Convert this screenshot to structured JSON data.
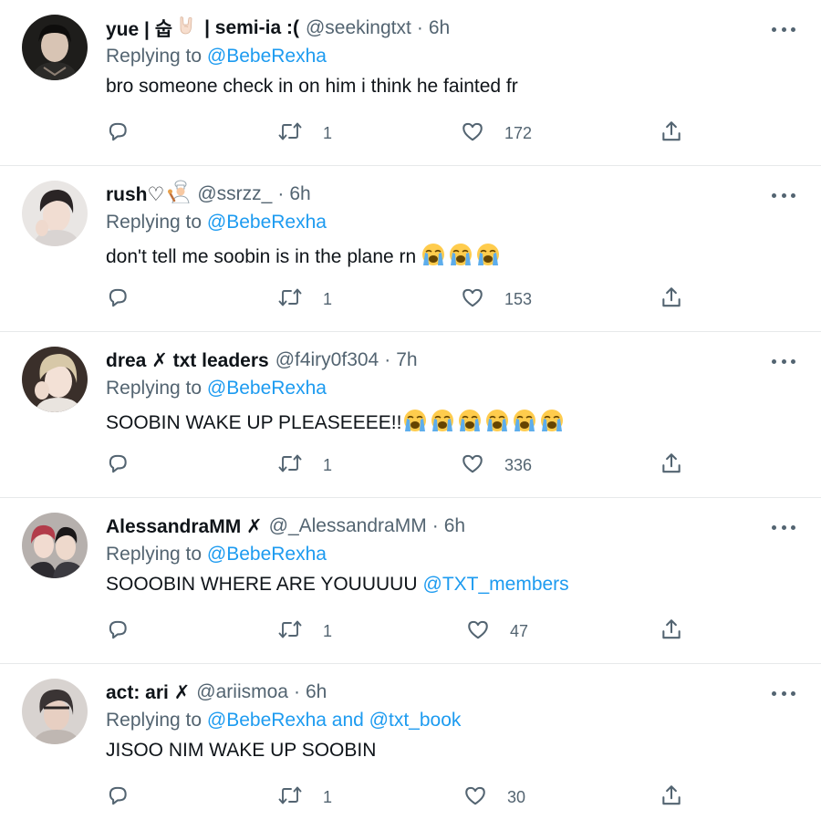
{
  "tweets": [
    {
      "display_name": "yue | 숩",
      "display_name_suffix": "| semi-ia :(",
      "name_emoji": "sign-of-horns-emoji",
      "handle": "@seekingtxt",
      "dot": "·",
      "time": "6h",
      "replying_prefix": "Replying to",
      "replying_to": "@BebeRexha",
      "text": "bro someone check in on him i think he fainted fr",
      "retweets": "1",
      "likes": "172"
    },
    {
      "display_name": "rush♡",
      "name_emoji": "chef-emoji",
      "handle": "@ssrzz_",
      "dot": "·",
      "time": "6h",
      "replying_prefix": "Replying to",
      "replying_to": "@BebeRexha",
      "text": "don't tell me soobin is in the plane rn",
      "text_emoji_count": 3,
      "retweets": "1",
      "likes": "153"
    },
    {
      "display_name": "drea ✗ txt leaders",
      "handle": "@f4iry0f304",
      "dot": "·",
      "time": "7h",
      "replying_prefix": "Replying to",
      "replying_to": "@BebeRexha",
      "text": "SOOBIN WAKE UP PLEASEEEE!!",
      "text_emoji_count": 6,
      "retweets": "1",
      "likes": "336"
    },
    {
      "display_name": "AlessandraMM ✗",
      "handle": "@_AlessandraMM",
      "dot": "·",
      "time": "6h",
      "replying_prefix": "Replying to",
      "replying_to": "@BebeRexha",
      "text": "SOOOBIN WHERE ARE YOUUUUU",
      "text_mention": "@TXT_members",
      "retweets": "1",
      "likes": "47"
    },
    {
      "display_name": "act: ari ✗",
      "handle": "@ariismoa",
      "dot": "·",
      "time": "6h",
      "replying_prefix": "Replying to",
      "replying_to": "@BebeRexha and @txt_book",
      "text": "JISOO NIM WAKE UP SOOBIN",
      "retweets": "1",
      "likes": "30"
    }
  ],
  "colors": {
    "text": "#0f1419",
    "secondary": "#536471",
    "link": "#1d9bf0",
    "divider": "#e7e9ea"
  },
  "icons": {
    "reply": "reply-icon",
    "retweet": "retweet-icon",
    "like": "heart-icon",
    "share": "share-icon",
    "more": "more-icon",
    "crying": "loudly-crying-face-emoji"
  }
}
